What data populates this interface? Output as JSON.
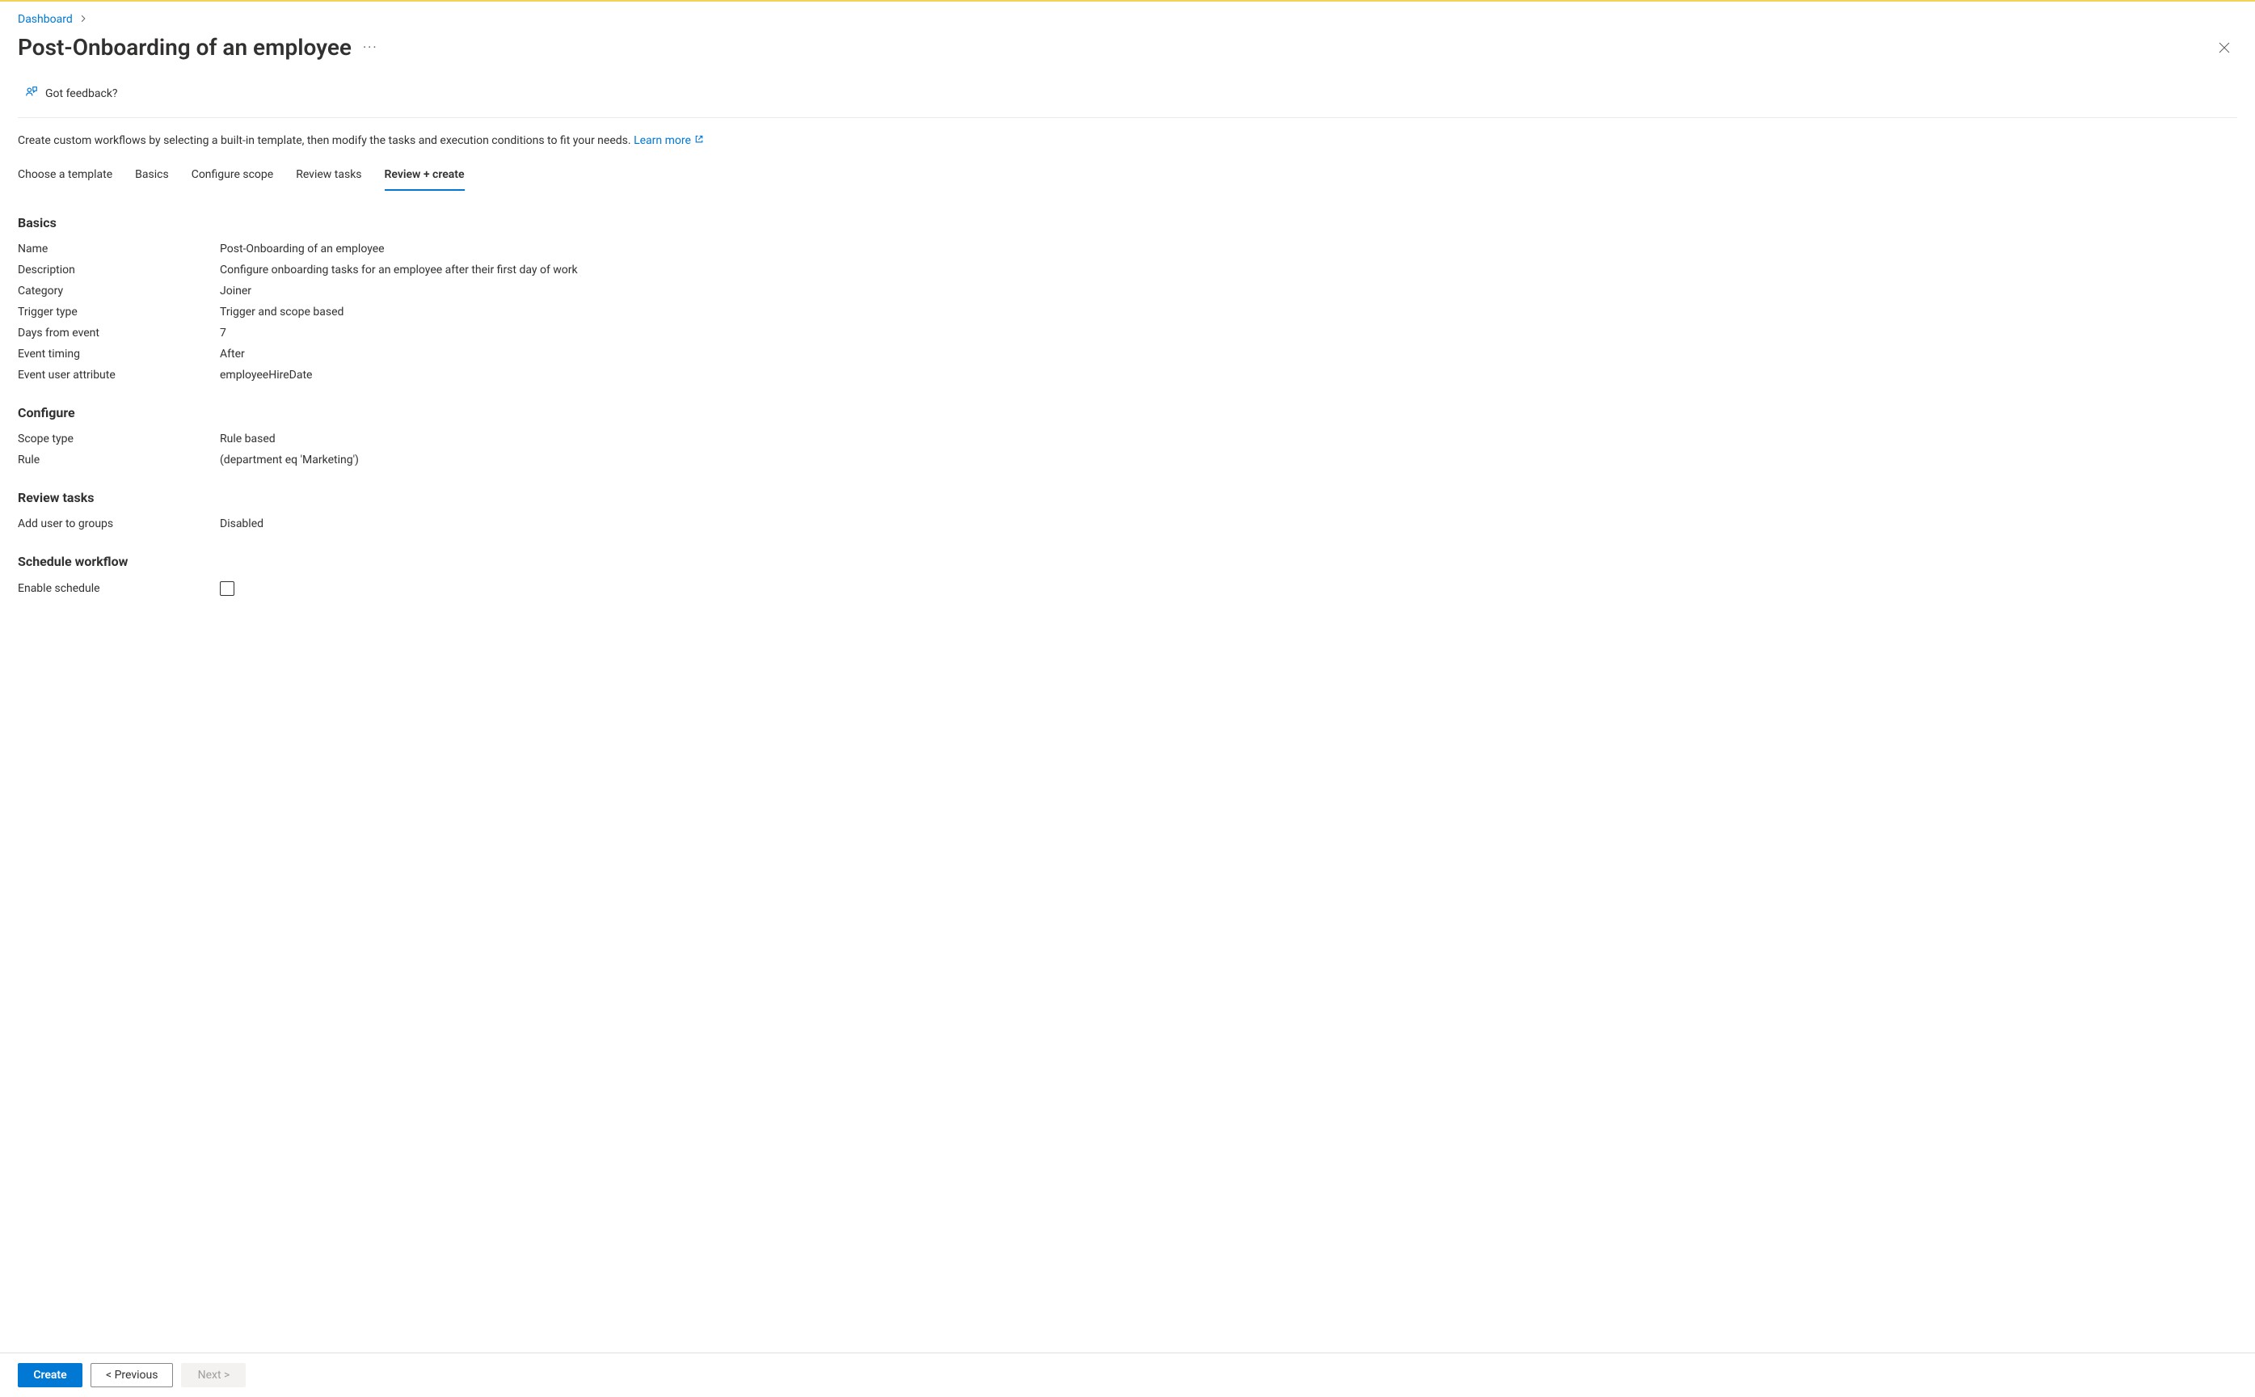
{
  "breadcrumb": {
    "dashboard": "Dashboard"
  },
  "header": {
    "title": "Post-Onboarding of an employee",
    "feedback": "Got feedback?"
  },
  "intro": {
    "text": "Create custom workflows by selecting a built-in template, then modify the tasks and execution conditions to fit your needs. ",
    "learn_more": "Learn more"
  },
  "tabs": {
    "choose_template": "Choose a template",
    "basics": "Basics",
    "configure_scope": "Configure scope",
    "review_tasks": "Review tasks",
    "review_create": "Review + create"
  },
  "sections": {
    "basics": {
      "heading": "Basics",
      "rows": {
        "name": {
          "label": "Name",
          "value": "Post-Onboarding of an employee"
        },
        "description": {
          "label": "Description",
          "value": "Configure onboarding tasks for an employee after their first day of work"
        },
        "category": {
          "label": "Category",
          "value": "Joiner"
        },
        "trigger_type": {
          "label": "Trigger type",
          "value": "Trigger and scope based"
        },
        "days_from_event": {
          "label": "Days from event",
          "value": "7"
        },
        "event_timing": {
          "label": "Event timing",
          "value": "After"
        },
        "event_user_attribute": {
          "label": "Event user attribute",
          "value": "employeeHireDate"
        }
      }
    },
    "configure": {
      "heading": "Configure",
      "rows": {
        "scope_type": {
          "label": "Scope type",
          "value": "Rule based"
        },
        "rule": {
          "label": "Rule",
          "value": "(department eq 'Marketing')"
        }
      }
    },
    "review_tasks": {
      "heading": "Review tasks",
      "rows": {
        "add_user": {
          "label": "Add user to groups",
          "value": "Disabled"
        }
      }
    },
    "schedule": {
      "heading": "Schedule workflow",
      "rows": {
        "enable": {
          "label": "Enable schedule"
        }
      }
    }
  },
  "footer": {
    "create": "Create",
    "previous": "< Previous",
    "next": "Next >"
  }
}
